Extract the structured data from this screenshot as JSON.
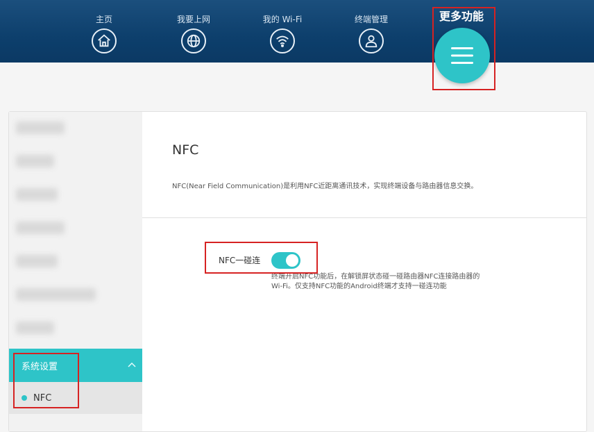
{
  "nav": {
    "items": [
      {
        "label": "主页",
        "icon": "home-icon"
      },
      {
        "label": "我要上网",
        "icon": "globe-icon"
      },
      {
        "label": "我的 Wi-Fi",
        "icon": "wifi-icon"
      },
      {
        "label": "终端管理",
        "icon": "user-icon"
      }
    ],
    "more_label": "更多功能",
    "more_icon": "menu-icon"
  },
  "sidebar": {
    "section_label": "系统设置",
    "section_icon": "chevron-up-icon",
    "sub_item_label": "NFC"
  },
  "content": {
    "title": "NFC",
    "description": "NFC(Near Field Communication)是利用NFC近距离通讯技术，实现终端设备与路由器信息交换。",
    "nfc_label": "NFC一碰连",
    "nfc_enabled": true,
    "hint_line1": "终端开启NFC功能后，在解锁屏状态碰一碰路由器NFC连接路由器的",
    "hint_line2": "Wi-Fi。仅支持NFC功能的Android终端才支持一碰连功能"
  },
  "colors": {
    "header": "#0d3f6c",
    "accent": "#2ec4c8",
    "highlight_box": "#d62222"
  }
}
